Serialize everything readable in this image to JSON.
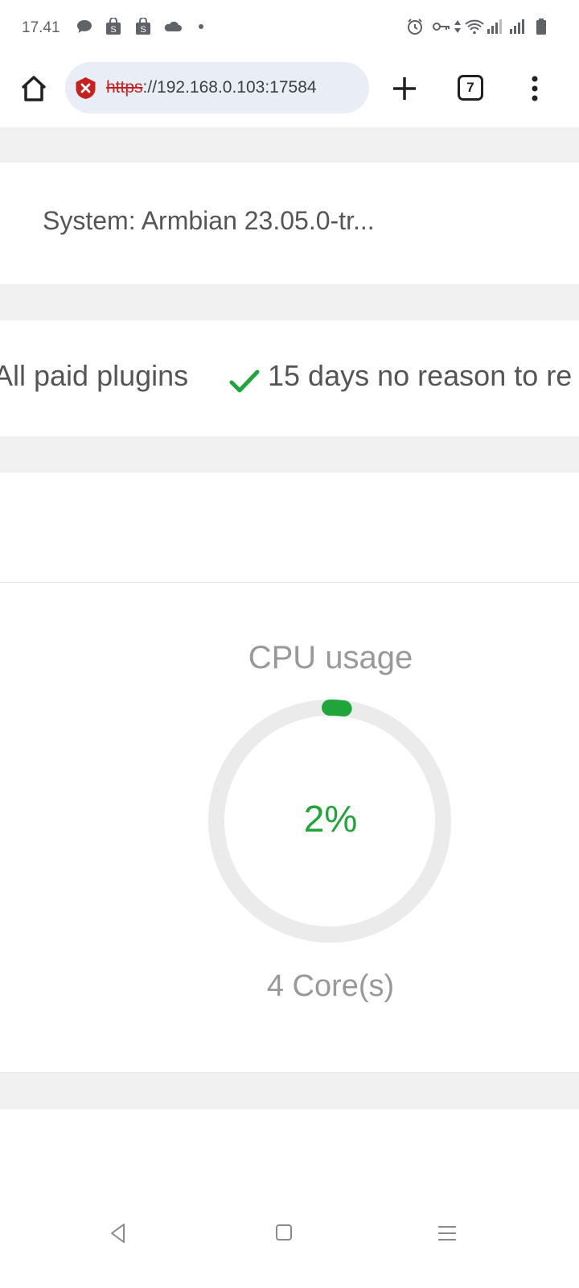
{
  "status_bar": {
    "time": "17.41",
    "left_icons": [
      "chat-bubble-icon",
      "shop-bag-icon",
      "shop-bag-icon",
      "cloud-icon",
      "dot-icon"
    ],
    "right_icons": [
      "alarm-icon",
      "vpn-key-icon",
      "data-arrows-icon",
      "wifi-icon",
      "signal-icon",
      "signal-icon",
      "battery-icon"
    ]
  },
  "browser": {
    "url_scheme": "https",
    "url_rest": "://192.168.0.103:17584",
    "tab_count": "7",
    "security_state": "not-secure",
    "colors": {
      "url_bar_bg": "#e9eef6",
      "insecure_red": "#c5221f"
    }
  },
  "page": {
    "system_label": "System: Armbian 23.05.0-tr...",
    "features": [
      "All paid plugins",
      "15 days no reason to re"
    ],
    "cpu": {
      "title": "CPU usage",
      "value": "2%",
      "usage_percent": 2,
      "cores_label": "4 Core(s)",
      "colors": {
        "accent": "#20a53a",
        "track": "#ebebeb"
      }
    }
  },
  "nav_bar": {
    "buttons": [
      "back-icon",
      "home-icon",
      "recents-icon"
    ]
  }
}
